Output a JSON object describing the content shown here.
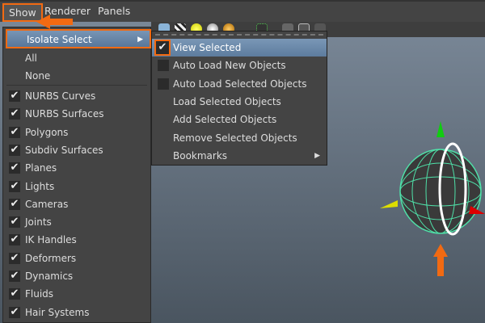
{
  "menubar": {
    "items": [
      "Show",
      "Renderer",
      "Panels"
    ]
  },
  "show_menu": {
    "isolate_select": "Isolate Select",
    "all": "All",
    "none": "None",
    "items": [
      {
        "label": "NURBS Curves",
        "checked": true
      },
      {
        "label": "NURBS Surfaces",
        "checked": true
      },
      {
        "label": "Polygons",
        "checked": true
      },
      {
        "label": "Subdiv Surfaces",
        "checked": true
      },
      {
        "label": "Planes",
        "checked": true
      },
      {
        "label": "Lights",
        "checked": true
      },
      {
        "label": "Cameras",
        "checked": true
      },
      {
        "label": "Joints",
        "checked": true
      },
      {
        "label": "IK Handles",
        "checked": true
      },
      {
        "label": "Deformers",
        "checked": true
      },
      {
        "label": "Dynamics",
        "checked": true
      },
      {
        "label": "Fluids",
        "checked": true
      },
      {
        "label": "Hair Systems",
        "checked": true
      }
    ]
  },
  "isolate_submenu": {
    "items": [
      {
        "label": "View Selected",
        "checked": true
      },
      {
        "label": "Auto Load New Objects",
        "checked": false
      },
      {
        "label": "Auto Load Selected Objects",
        "checked": false
      },
      {
        "label": "Load Selected Objects"
      },
      {
        "label": "Add Selected Objects"
      },
      {
        "label": "Remove Selected Objects"
      },
      {
        "label": "Bookmarks",
        "submenu": true
      }
    ]
  },
  "colors": {
    "highlight": "#f26a12",
    "menu_bg": "#444444",
    "selected": "#6a88a8"
  }
}
